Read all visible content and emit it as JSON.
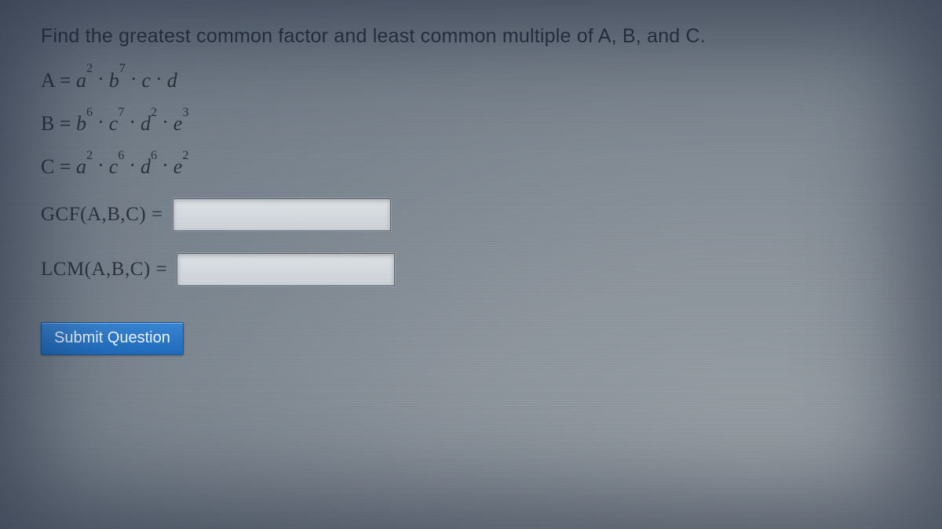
{
  "title": "Find the greatest common factor and least common multiple of A, B, and C.",
  "expressions": {
    "A": {
      "label": "A",
      "vars": [
        {
          "sym": "a",
          "exp": "2"
        },
        {
          "sym": "b",
          "exp": "7"
        },
        {
          "sym": "c",
          "exp": ""
        },
        {
          "sym": "d",
          "exp": ""
        }
      ]
    },
    "B": {
      "label": "B",
      "vars": [
        {
          "sym": "b",
          "exp": "6"
        },
        {
          "sym": "c",
          "exp": "7"
        },
        {
          "sym": "d",
          "exp": "2"
        },
        {
          "sym": "e",
          "exp": "3"
        }
      ]
    },
    "C": {
      "label": "C",
      "vars": [
        {
          "sym": "a",
          "exp": "2"
        },
        {
          "sym": "c",
          "exp": "6"
        },
        {
          "sym": "d",
          "exp": "6"
        },
        {
          "sym": "e",
          "exp": "2"
        }
      ]
    }
  },
  "gcf": {
    "label": "GCF(A,B,C) =",
    "value": ""
  },
  "lcm": {
    "label": "LCM(A,B,C) =",
    "value": ""
  },
  "submit_label": "Submit Question",
  "dot": "·",
  "eq": " = "
}
